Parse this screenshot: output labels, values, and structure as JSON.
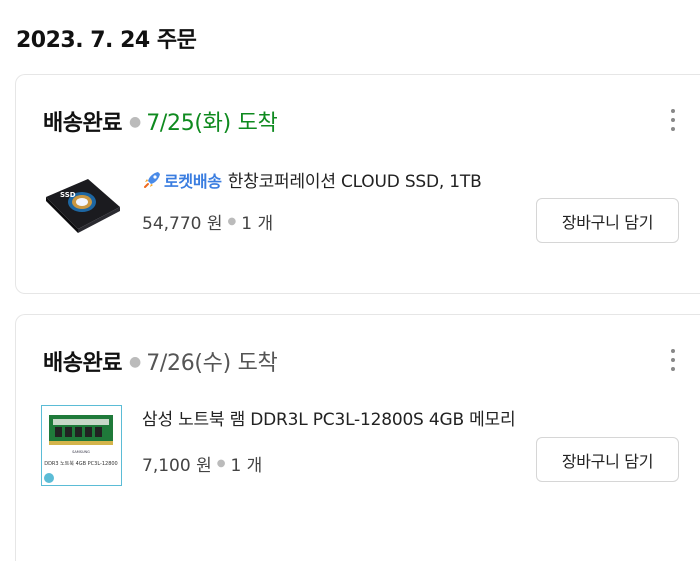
{
  "order": {
    "date_title": "2023. 7. 24 주문"
  },
  "items": [
    {
      "status": "배송완료",
      "arrival": "7/25(화) 도착",
      "rocket_label": "로켓배송",
      "product_name": "한창코퍼레이션 CLOUD SSD, 1TB",
      "price": "54,770 원",
      "quantity": "1 개",
      "cart_button": "장바구니 담기",
      "arrival_color": "#0f8a1f",
      "thumbnail_icon": "ssd-product-image",
      "thumbnail_text": "SSD"
    },
    {
      "status": "배송완료",
      "arrival": "7/26(수) 도착",
      "product_name": "삼성 노트북 램 DDR3L PC3L-12800S 4GB 메모리",
      "price": "7,100 원",
      "quantity": "1 개",
      "cart_button": "장바구니 담기",
      "arrival_color": "#555555",
      "thumbnail_icon": "ram-product-image",
      "thumbnail_caption": "DDR3 노트북 4GB PC3L-12800",
      "thumbnail_brand": "SAMSUNG"
    }
  ]
}
